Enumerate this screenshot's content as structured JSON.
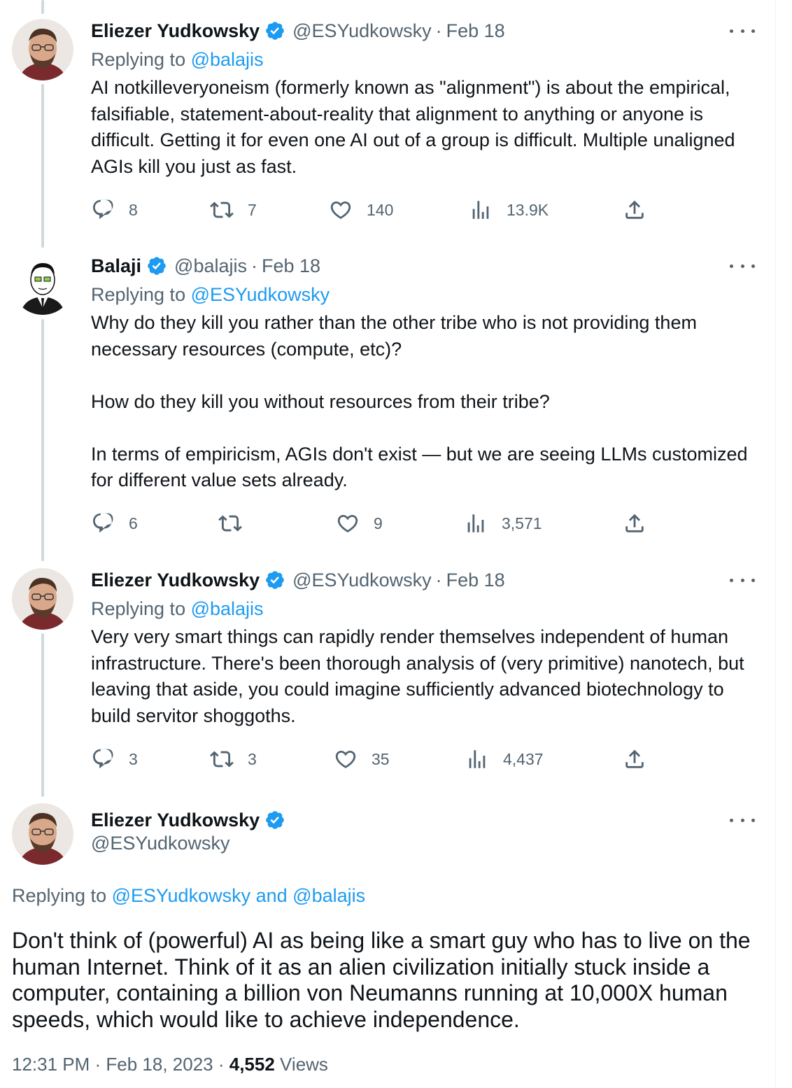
{
  "colors": {
    "accent": "#1d9bf0",
    "text_primary": "#0f1419",
    "text_secondary": "#536471",
    "thread_line": "#cfd9de"
  },
  "icons": {
    "reply": "speech-bubble-icon",
    "retweet": "retweet-icon",
    "like": "heart-icon",
    "views": "bar-chart-icon",
    "share": "share-upload-icon",
    "verified": "verified-badge-icon",
    "more": "more-dots-icon"
  },
  "tweets": [
    {
      "name": "Eliezer Yudkowsky",
      "handle": "@ESYudkowsky",
      "sep": "·",
      "date": "Feb 18",
      "replying_prefix": "Replying to ",
      "replying_to": "@balajis",
      "text": [
        "AI notkilleveryoneism (formerly known as \"alignment\") is about the empirical, falsifiable, statement-about-reality that alignment to anything or anyone is difficult.  Getting it for even one AI out of a group is difficult.  Multiple unaligned AGIs kill you just as fast."
      ],
      "replies": "8",
      "retweets": "7",
      "likes": "140",
      "views": "13.9K"
    },
    {
      "name": "Balaji",
      "handle": "@balajis",
      "sep": "·",
      "date": "Feb 18",
      "replying_prefix": "Replying to ",
      "replying_to": "@ESYudkowsky",
      "text": [
        "Why do they kill you rather than the other tribe who is not providing them necessary resources (compute, etc)?",
        "How do they kill you without resources from their tribe?",
        "In terms of empiricism, AGIs don't exist — but we are seeing LLMs customized for different value sets already."
      ],
      "replies": "6",
      "retweets": "",
      "likes": "9",
      "views": "3,571"
    },
    {
      "name": "Eliezer Yudkowsky",
      "handle": "@ESYudkowsky",
      "sep": "·",
      "date": "Feb 18",
      "replying_prefix": "Replying to ",
      "replying_to": "@balajis",
      "text": [
        "Very very smart things can rapidly render themselves independent of human infrastructure.  There's been thorough analysis of (very primitive) nanotech, but leaving that aside, you could imagine sufficiently advanced biotechnology to build servitor shoggoths."
      ],
      "replies": "3",
      "retweets": "3",
      "likes": "35",
      "views": "4,437"
    }
  ],
  "main_tweet": {
    "name": "Eliezer Yudkowsky",
    "handle": "@ESYudkowsky",
    "replying_prefix": "Replying to ",
    "replying_to_1": "@ESYudkowsky",
    "replying_and": " and ",
    "replying_to_2": "@balajis",
    "text": "Don't think of (powerful) AI as being like a smart guy who has to live on the human Internet.  Think of it as an alien civilization initially stuck inside a computer, containing a billion von Neumanns running at 10,000X human speeds, which would like to achieve independence.",
    "time": "12:31 PM",
    "sep": " · ",
    "date": "Feb 18, 2023",
    "views_count": "4,552",
    "views_label": " Views"
  }
}
